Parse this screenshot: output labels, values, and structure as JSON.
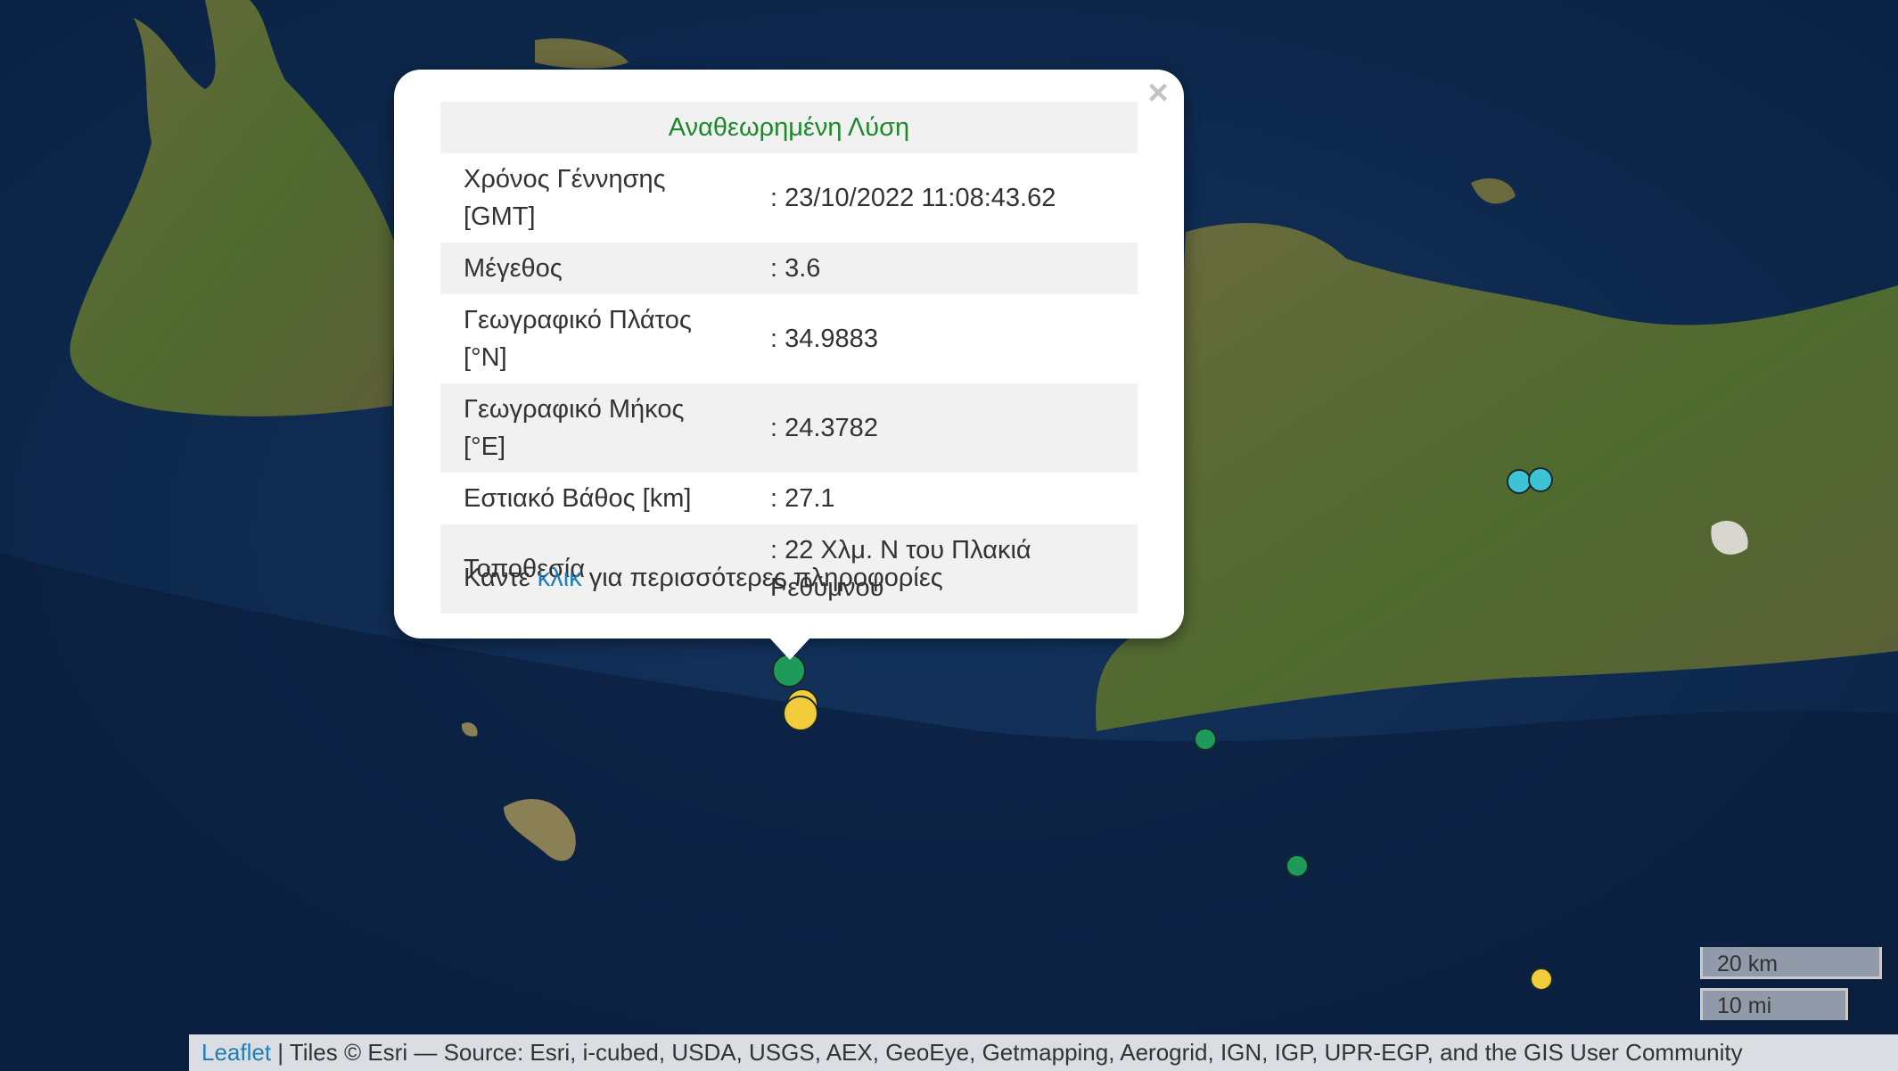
{
  "popup": {
    "title": "Αναθεωρημένη Λύση",
    "close_glyph": "×",
    "rows": [
      {
        "label": "Χρόνος Γέννησης [GMT]",
        "value": ": 23/10/2022 11:08:43.62"
      },
      {
        "label": "Μέγεθος",
        "value": ": 3.6"
      },
      {
        "label": "Γεωγραφικό Πλάτος [°N]",
        "value": ": 34.9883"
      },
      {
        "label": "Γεωγραφικό Μήκος [°E]",
        "value": ": 24.3782"
      },
      {
        "label": "Εστιακό Βάθος [km]",
        "value": ": 27.1"
      },
      {
        "label": "Τοποθεσία",
        "value": ": 22 Χλμ. Ν του Πλακιά Ρεθύμνου"
      }
    ],
    "more_prefix": "Κάντε ",
    "more_link": "κλικ",
    "more_suffix": " για περισσότερες πληροφορίες"
  },
  "scale": {
    "km": "20 km",
    "mi": "10 mi"
  },
  "attribution": {
    "leaflet": "Leaflet",
    "text": " | Tiles © Esri — Source: Esri, i-cubed, USDA, USGS, AEX, GeoEye, Getmapping, Aerogrid, IGN, IGP, UPR-EGP, and the GIS User Community"
  },
  "colors": {
    "title_green": "#1c8a2b",
    "link_blue": "#1f7fb8",
    "quake_green": "#1e9a5a",
    "quake_yellow": "#f2cc3a",
    "quake_cyan": "#3cc4d6"
  }
}
